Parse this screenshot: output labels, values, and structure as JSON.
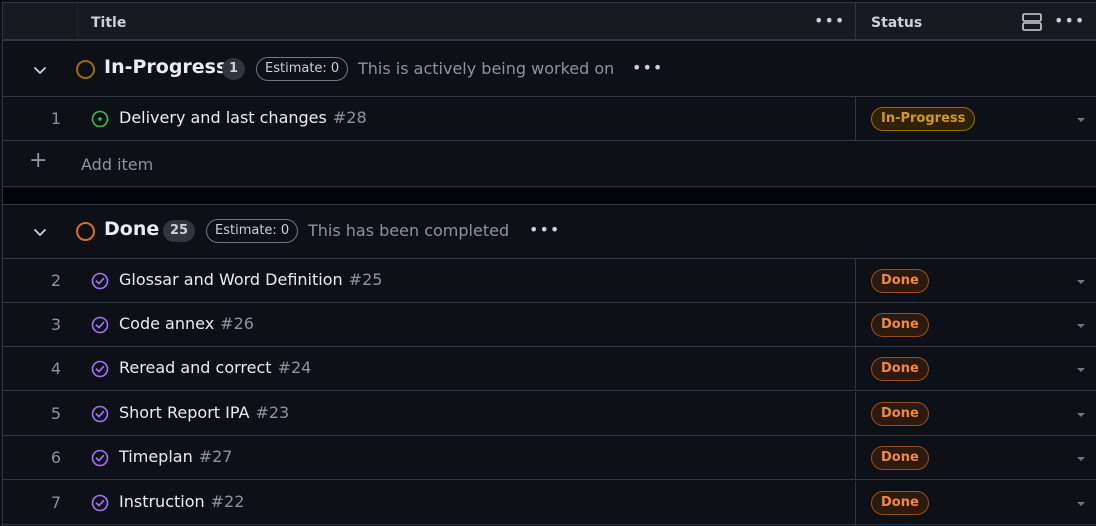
{
  "header": {
    "title_col": "Title",
    "status_col": "Status",
    "more_icon": "kebab-horizontal-icon",
    "layout_icon": "rows-layout-icon"
  },
  "groups": [
    {
      "name": "In-Progress",
      "count": "1",
      "estimate": "Estimate: 0",
      "description": "This is actively being worked on",
      "color": "#9e6a03",
      "items": [
        {
          "num": "1",
          "title": "Delivery and last changes",
          "issue": "#28",
          "status": "In-Progress",
          "icon": "issue-open-icon"
        }
      ],
      "add_label": "Add item"
    },
    {
      "name": "Done",
      "count": "25",
      "estimate": "Estimate: 0",
      "description": "This has been completed",
      "color": "#db6d28",
      "items": [
        {
          "num": "2",
          "title": "Glossar and Word Definition",
          "issue": "#25",
          "status": "Done",
          "icon": "issue-closed-icon"
        },
        {
          "num": "3",
          "title": "Code annex",
          "issue": "#26",
          "status": "Done",
          "icon": "issue-closed-icon"
        },
        {
          "num": "4",
          "title": "Reread and correct",
          "issue": "#24",
          "status": "Done",
          "icon": "issue-closed-icon"
        },
        {
          "num": "5",
          "title": "Short Report IPA",
          "issue": "#23",
          "status": "Done",
          "icon": "issue-closed-icon"
        },
        {
          "num": "6",
          "title": "Timeplan",
          "issue": "#27",
          "status": "Done",
          "icon": "issue-closed-icon"
        },
        {
          "num": "7",
          "title": "Instruction",
          "issue": "#22",
          "status": "Done",
          "icon": "issue-closed-icon"
        }
      ]
    }
  ],
  "colors": {
    "open_icon": "#3fb950",
    "closed_icon": "#a371f7",
    "in_progress": "#d29922",
    "done": "#f0883e"
  }
}
